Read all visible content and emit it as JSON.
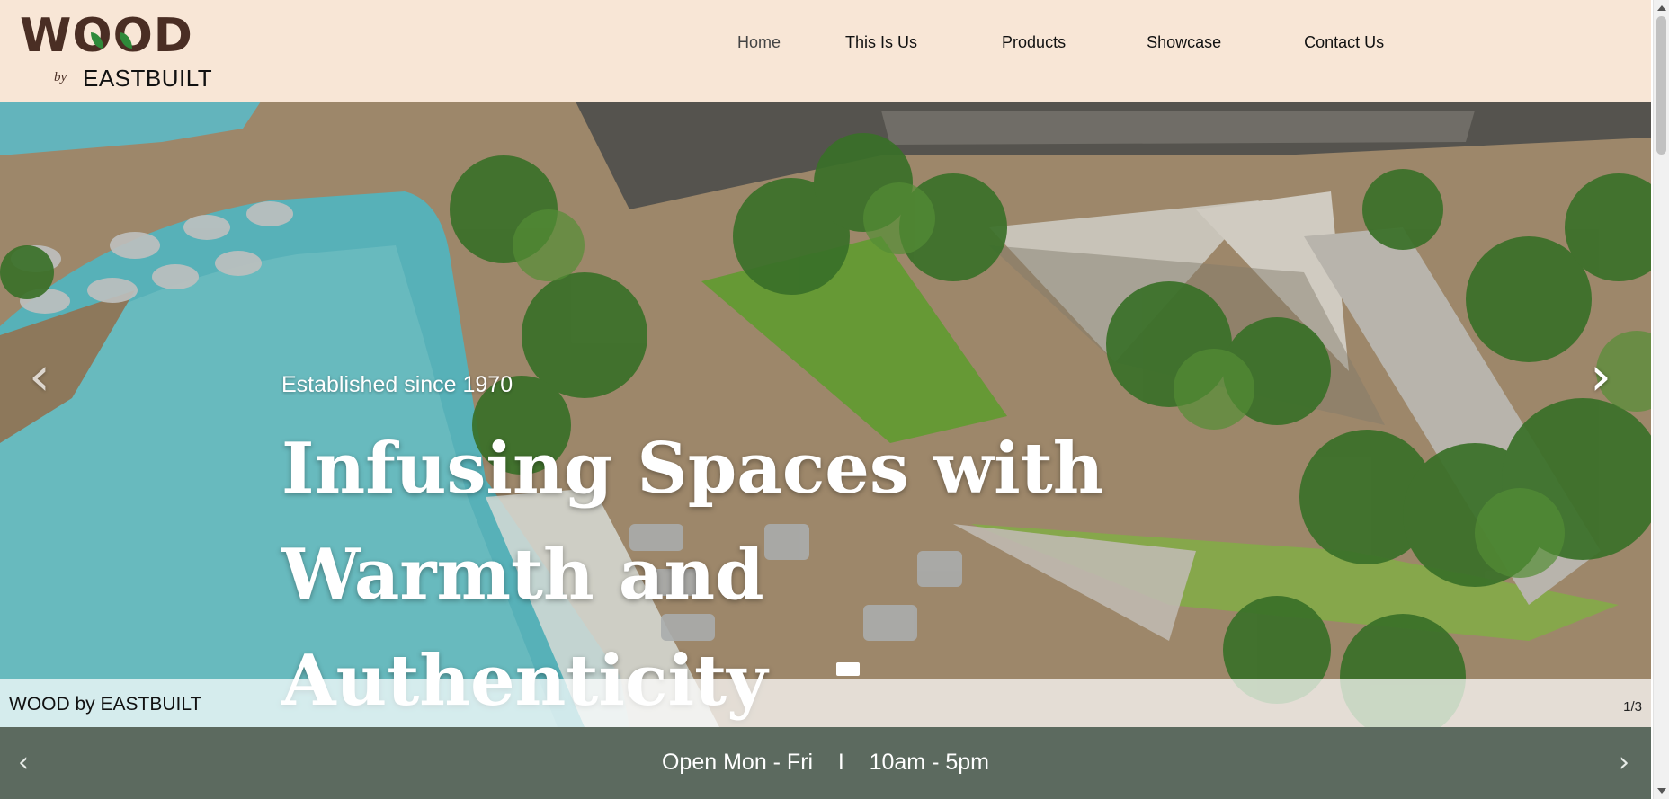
{
  "header": {
    "logo": {
      "main": "WOOD",
      "by": "by",
      "sub": "EASTBUILT"
    },
    "nav": [
      {
        "label": "Home",
        "active": true
      },
      {
        "label": "This Is Us",
        "active": false
      },
      {
        "label": "Products",
        "active": false
      },
      {
        "label": "Showcase",
        "active": false
      },
      {
        "label": "Contact Us",
        "active": false
      }
    ]
  },
  "hero": {
    "eyebrow": "Established since 1970",
    "title_line1": "Infusing Spaces with",
    "title_line2": "Warmth and Authenticity",
    "caption": "WOOD by EASTBUILT",
    "counter": "1/3",
    "prev_icon": "chevron-left-icon",
    "next_icon": "chevron-right-icon"
  },
  "bottom_bar": {
    "hours": "Open Mon - Fri    I    10am - 5pm",
    "prev_icon": "chevron-left-icon",
    "next_icon": "chevron-right-icon"
  },
  "colors": {
    "header_bg": "#f8e6d6",
    "brand_brown": "#4a2e24",
    "leaf_green": "#2e8a3a",
    "bottom_bar_bg": "#5c6a5f",
    "pool": "#5fc0c8"
  }
}
